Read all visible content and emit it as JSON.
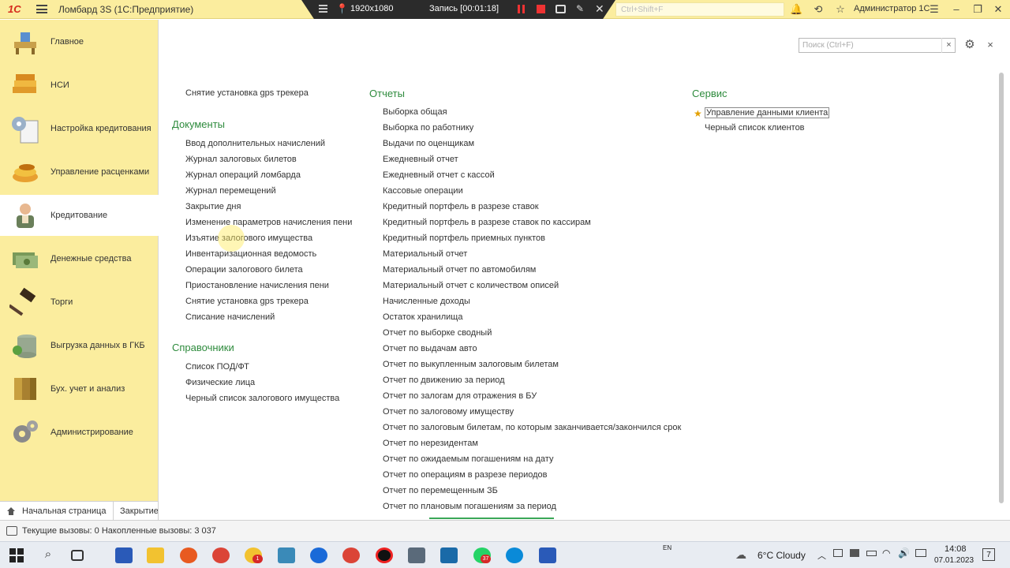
{
  "titlebar": {
    "logo": "1С",
    "title": "Ломбард 3S  (1С:Предприятие)",
    "search_placeholder": "Ctrl+Shift+F",
    "user": "Администратор 1С"
  },
  "recorder": {
    "resolution": "1920x1080",
    "recording": "Запись [00:01:18]"
  },
  "sections": [
    {
      "label": "Главное",
      "icon": "home-desk-icon"
    },
    {
      "label": "НСИ",
      "icon": "books-icon"
    },
    {
      "label": "Настройка кредитования",
      "icon": "settings-document-icon"
    },
    {
      "label": "Управление расценками",
      "icon": "coins-icon"
    },
    {
      "label": "Кредитование",
      "icon": "person-icon"
    },
    {
      "label": "Денежные средства",
      "icon": "money-icon"
    },
    {
      "label": "Торги",
      "icon": "gavel-icon"
    },
    {
      "label": "Выгрузка данных в  ГКБ",
      "icon": "database-icon"
    },
    {
      "label": "Бух. учет и анализ",
      "icon": "ledger-icon"
    },
    {
      "label": "Администрирование",
      "icon": "gears-icon"
    }
  ],
  "active_section": "Кредитование",
  "bottom_tabs": [
    "Начальная страница",
    "Закрытие"
  ],
  "main": {
    "search_placeholder": "Поиск (Ctrl+F)",
    "clear": "×",
    "close": "×",
    "col1_top": "Снятие установка gps трекера",
    "documents_title": "Документы",
    "documents": [
      "Ввод дополнительных начислений",
      "Журнал залоговых билетов",
      "Журнал операций ломбарда",
      "Журнал перемещений",
      "Закрытие дня",
      "Изменение параметров начисления пени",
      "Изъятие залогового имущества",
      "Инвентаризационная ведомость",
      "Операции залогового билета",
      "Приостановление начисления пени",
      "Снятие установка gps трекера",
      "Списание начислений"
    ],
    "directories_title": "Справочники",
    "directories": [
      "Список ПОД/ФТ",
      "Физические лица",
      "Черный список залогового имущества"
    ],
    "reports_title": "Отчеты",
    "reports": [
      "Выборка общая",
      "Выборка по работнику",
      "Выдачи по оценщикам",
      "Ежедневный отчет",
      "Ежедневный отчет с кассой",
      "Кассовые операции",
      "Кредитный портфель в разрезе ставок",
      "Кредитный портфель в разрезе ставок по кассирам",
      "Кредитный портфель приемных пунктов",
      "Материальный отчет",
      "Материальный отчет по автомобилям",
      "Материальный отчет с количеством описей",
      "Начисленные доходы",
      "Остаток хранилища",
      "Отчет по выборке сводный",
      "Отчет по выдачам авто",
      "Отчет по выкупленным залоговым билетам",
      "Отчет по движению за период",
      "Отчет по залогам для отражения в БУ",
      "Отчет по залоговому имуществу",
      "Отчет по залоговым билетам, по которым заканчивается/закончился срок",
      "Отчет по нерезидентам",
      "Отчет по ожидаемым погашениям на дату",
      "Отчет по операциям в разрезе периодов",
      "Отчет по перемещенным ЗБ",
      "Отчет по плановым погашениям за период"
    ],
    "service_title": "Сервис",
    "service": [
      "Управление данными клиента",
      "Черный список клиентов"
    ]
  },
  "status": {
    "text": "Текущие вызовы: 0   Накопленные вызовы: 3 037"
  },
  "taskbar": {
    "weather": "6°C  Cloudy",
    "lang": "EN",
    "time": "14:08",
    "date": "07.01.2023",
    "badge_yandex": "1",
    "badge_whatsapp": "37",
    "notif_count": "7"
  }
}
